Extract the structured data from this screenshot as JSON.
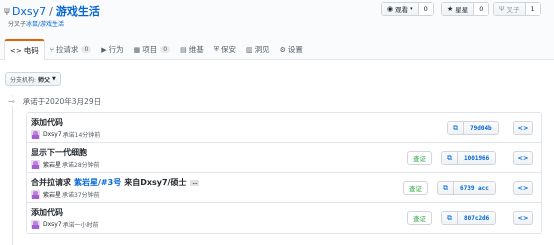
{
  "repo": {
    "owner": "Dxsy7",
    "separator": "/",
    "name": "游戏生活",
    "forked_prefix": "分叉子",
    "forked_from": "冰鼠/游戏生活"
  },
  "actions": {
    "watch_label": "观看",
    "watch_count": "0",
    "star_label": "星星",
    "star_count": "0",
    "fork_label": "叉子",
    "fork_count": "1"
  },
  "tabs": [
    {
      "label": "电码"
    },
    {
      "label": "拉请求",
      "count": "0"
    },
    {
      "label": "行为"
    },
    {
      "label": "项目",
      "count": "0"
    },
    {
      "label": "维基"
    },
    {
      "label": "保安"
    },
    {
      "label": "洞见"
    },
    {
      "label": "设置"
    }
  ],
  "branch": {
    "prefix": "分支机构:",
    "value": "师父"
  },
  "date_header": "承诺于2020年3月29日",
  "commits": [
    {
      "message": "添加代码",
      "author": "Dxsy7",
      "time": "承诺14分钟前",
      "verified": "",
      "sha": "79d04b"
    },
    {
      "message": "显示下一代细胞",
      "author": "紫岩星",
      "time": "承诺28分钟前",
      "verified": "查证",
      "sha": "1001966"
    },
    {
      "message": "合并拉请求",
      "pr": "紫岩星/#3号",
      "pr_suffix": "来自Dxsy7/硕士",
      "more": "…",
      "author": "紫岩星",
      "time": "承诺37分钟前",
      "verified": "查证",
      "sha": "6739 acc"
    },
    {
      "message": "添加代码",
      "author": "Dxsy7",
      "time": "承诺一小时前",
      "verified": "查证",
      "sha": "807c2d6"
    }
  ]
}
